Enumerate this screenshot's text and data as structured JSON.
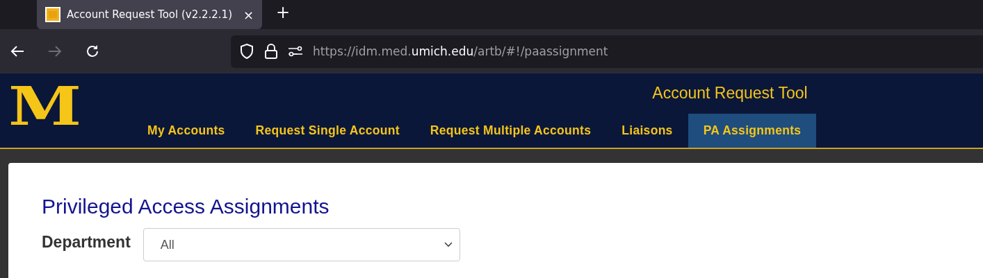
{
  "browser": {
    "tab": {
      "title": "Account Request Tool (v2.2.2.1)",
      "close": "×",
      "selected": true
    },
    "new_tab": "+",
    "back_enabled": true,
    "forward_enabled": false,
    "url": [
      {
        "text": "https://idm.med.",
        "highlight": false
      },
      {
        "text": "umich.edu",
        "highlight": true
      },
      {
        "text": "/artb/#!/paassignment",
        "highlight": false
      }
    ]
  },
  "header": {
    "logo": "M",
    "title": "Account Request Tool",
    "nav": [
      {
        "label": "My Accounts",
        "selected": false
      },
      {
        "label": "Request Single Account",
        "selected": false
      },
      {
        "label": "Request Multiple Accounts",
        "selected": false
      },
      {
        "label": "Liaisons",
        "selected": false
      },
      {
        "label": "PA Assignments",
        "selected": true
      }
    ]
  },
  "page": {
    "title": "Privileged Access Assignments",
    "filter": {
      "label": "Department",
      "value": "All"
    }
  }
}
